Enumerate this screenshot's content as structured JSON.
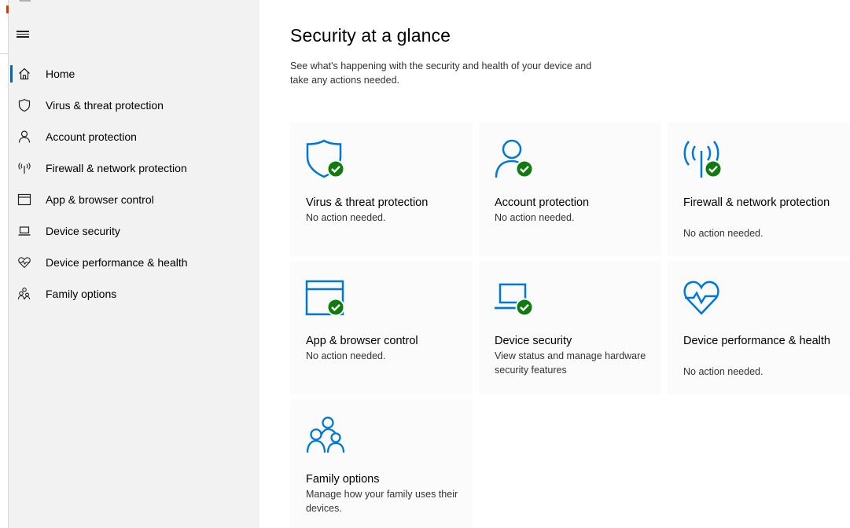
{
  "colors": {
    "accent": "#0067b8",
    "icon_blue": "#0078d7",
    "ok_green": "#107c10",
    "sidebar_bg": "#f2f2f2"
  },
  "sidebar": {
    "items": [
      {
        "label": "Home",
        "icon": "home-icon",
        "selected": true
      },
      {
        "label": "Virus & threat protection",
        "icon": "shield-icon"
      },
      {
        "label": "Account protection",
        "icon": "person-icon"
      },
      {
        "label": "Firewall & network protection",
        "icon": "antenna-icon"
      },
      {
        "label": "App & browser control",
        "icon": "browser-window-icon"
      },
      {
        "label": "Device security",
        "icon": "laptop-icon"
      },
      {
        "label": "Device performance & health",
        "icon": "heart-pulse-icon"
      },
      {
        "label": "Family options",
        "icon": "family-icon"
      }
    ]
  },
  "main": {
    "title": "Security at a glance",
    "subtitle": "See what's happening with the security and health of your device and take any actions needed.",
    "tiles": [
      {
        "title": "Virus & threat protection",
        "status": "No action needed.",
        "icon": "shield-check-icon"
      },
      {
        "title": "Account protection",
        "status": "No action needed.",
        "icon": "person-check-icon"
      },
      {
        "title": "Firewall & network protection",
        "status": "No action needed.",
        "icon": "antenna-check-icon"
      },
      {
        "title": "App & browser control",
        "status": "No action needed.",
        "icon": "browser-check-icon"
      },
      {
        "title": "Device security",
        "status": "View status and manage hardware security features",
        "icon": "laptop-check-icon"
      },
      {
        "title": "Device performance & health",
        "status": "No action needed.",
        "icon": "heart-pulse-icon"
      },
      {
        "title": "Family options",
        "status": "Manage how your family uses their devices.",
        "icon": "family-icon"
      }
    ]
  }
}
